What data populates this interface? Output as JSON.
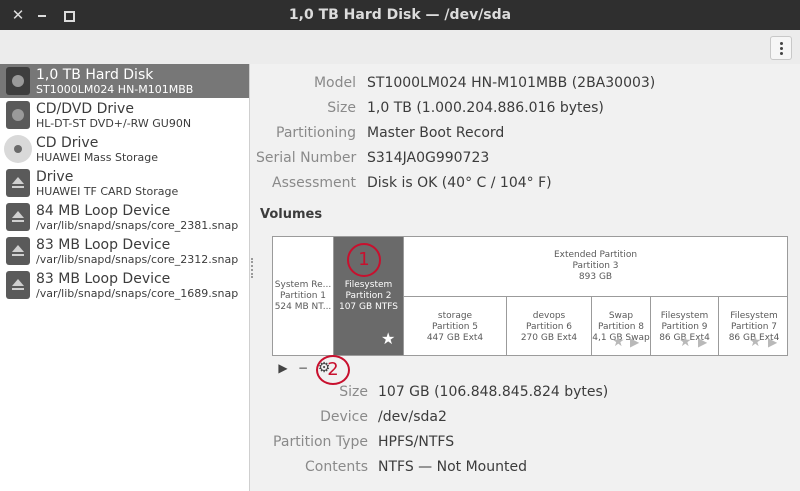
{
  "window": {
    "title": "1,0 TB Hard Disk — /dev/sda",
    "close_icon": "close-icon",
    "min_icon": "minimize-icon",
    "max_icon": "maximize-icon",
    "menu_icon": "vertical-dots-menu-icon"
  },
  "sidebar": {
    "devices": [
      {
        "name": "1,0 TB Hard Disk",
        "sub": "ST1000LM024 HN-M101MBB",
        "icon": "hard-disk-icon",
        "selected": true
      },
      {
        "name": "CD/DVD Drive",
        "sub": "HL-DT-ST DVD+/-RW GU90N",
        "icon": "optical-drive-icon"
      },
      {
        "name": "CD Drive",
        "sub": "HUAWEI Mass Storage",
        "icon": "cd-disc-icon"
      },
      {
        "name": "Drive",
        "sub": "HUAWEI TF CARD Storage",
        "icon": "removable-drive-icon"
      },
      {
        "name": "84 MB Loop Device",
        "sub": "/var/lib/snapd/snaps/core_2381.snap",
        "icon": "loop-device-icon"
      },
      {
        "name": "83 MB Loop Device",
        "sub": "/var/lib/snapd/snaps/core_2312.snap",
        "icon": "loop-device-icon"
      },
      {
        "name": "83 MB Loop Device",
        "sub": "/var/lib/snapd/snaps/core_1689.snap",
        "icon": "loop-device-icon"
      }
    ]
  },
  "disk": {
    "model_label": "Model",
    "model": "ST1000LM024 HN-M101MBB (2BA30003)",
    "size_label": "Size",
    "size": "1,0 TB (1.000.204.886.016 bytes)",
    "partitioning_label": "Partitioning",
    "partitioning": "Master Boot Record",
    "serial_label": "Serial Number",
    "serial": "S314JA0G990723",
    "assessment_label": "Assessment",
    "assessment": "Disk is OK (40° C / 104° F)"
  },
  "volumes": {
    "title": "Volumes",
    "p1": {
      "l1": "System Re...",
      "l2": "Partition 1",
      "l3": "524 MB NT..."
    },
    "p2": {
      "l1": "Filesystem",
      "l2": "Partition 2",
      "l3": "107 GB NTFS"
    },
    "ext": {
      "l1": "Extended Partition",
      "l2": "Partition 3",
      "l3": "893 GB"
    },
    "p5": {
      "l1": "storage",
      "l2": "Partition 5",
      "l3": "447 GB Ext4"
    },
    "p6": {
      "l1": "devops",
      "l2": "Partition 6",
      "l3": "270 GB Ext4"
    },
    "p8": {
      "l1": "Swap",
      "l2": "Partition 8",
      "l3": "4,1 GB Swap"
    },
    "p9": {
      "l1": "Filesystem",
      "l2": "Partition 9",
      "l3": "86 GB Ext4"
    },
    "p7": {
      "l1": "Filesystem",
      "l2": "Partition 7",
      "l3": "86 GB Ext4"
    },
    "annotation_1": "1",
    "annotation_2": "2",
    "star": "★",
    "play": "▶",
    "minus": "−",
    "gear": "⚙"
  },
  "selected_volume": {
    "size_label": "Size",
    "size": "107 GB (106.848.845.824 bytes)",
    "device_label": "Device",
    "device": "/dev/sda2",
    "ptype_label": "Partition Type",
    "ptype": "HPFS/NTFS",
    "contents_label": "Contents",
    "contents": "NTFS — Not Mounted"
  }
}
